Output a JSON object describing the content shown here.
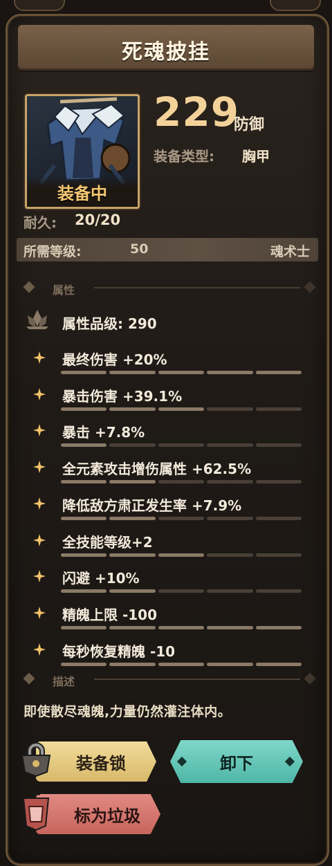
{
  "item": {
    "name": "死魂披挂",
    "equipped_tag": "装备中",
    "defense_value": "229",
    "defense_label": "防御",
    "equip_type_label": "装备类型:",
    "equip_type_value": "胸甲",
    "durability_label": "耐久:",
    "durability_value": "20/20"
  },
  "requirement": {
    "level_label": "所需等级:",
    "level_value": "50",
    "class_name": "魂术士"
  },
  "attributes": {
    "section_title": "属性",
    "grade": "属性品级: 290",
    "rows": [
      {
        "text": "最终伤害 +20%",
        "level": 1.0
      },
      {
        "text": "暴击伤害 +39.1%",
        "level": 0.6
      },
      {
        "text": "暴击 +7.8%",
        "level": 0.2
      },
      {
        "text": "全元素攻击增伤属性 +62.5%",
        "level": 0.4
      },
      {
        "text": "降低敌方肃正发生率 +7.9%",
        "level": 0.4
      },
      {
        "text": "全技能等级+2",
        "level": 0.6
      },
      {
        "text": "闪避 +10%",
        "level": 0.4
      },
      {
        "text": "精魄上限 -100",
        "level": 1.0
      },
      {
        "text": "每秒恢复精魄 -10",
        "level": 1.0
      }
    ]
  },
  "description": {
    "section_title": "描述",
    "text": "即使散尽魂魄,力量仍然灌注体内。"
  },
  "buttons": {
    "lock": "装备锁",
    "unequip": "卸下",
    "trash": "标为垃圾"
  },
  "colors": {
    "accent_gold": "#f3d29a",
    "unequip_teal": "#4fb6a7",
    "trash_red": "#c7655c",
    "lock_gold": "#d8b96a"
  }
}
